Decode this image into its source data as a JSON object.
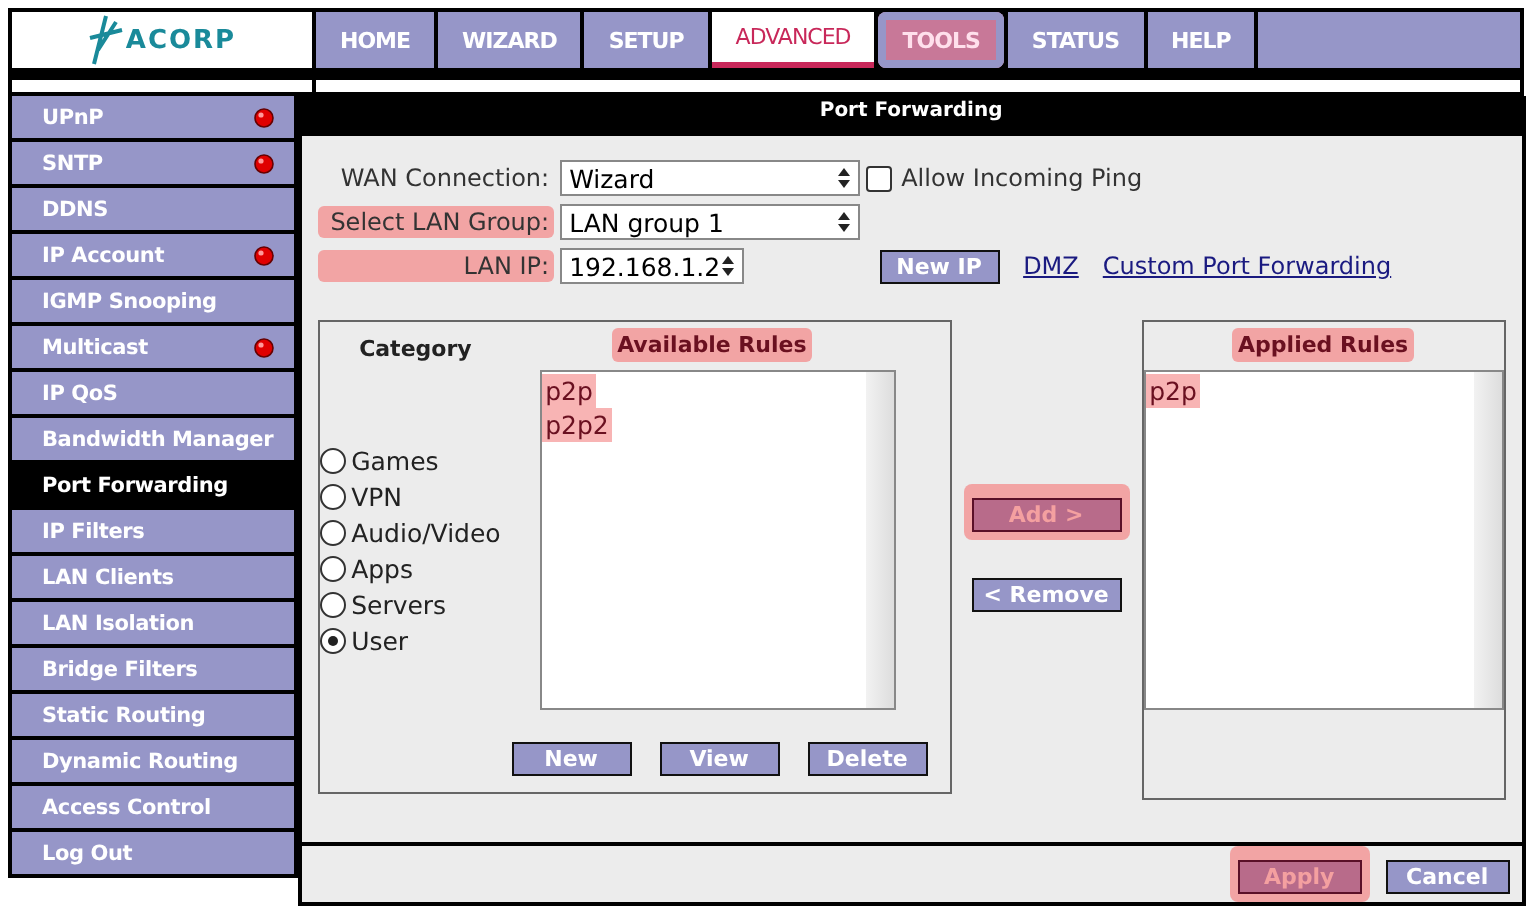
{
  "logo": "ACORP",
  "nav": [
    {
      "label": "HOME",
      "selected": false,
      "highlighted": false
    },
    {
      "label": "WIZARD",
      "selected": false,
      "highlighted": false
    },
    {
      "label": "SETUP",
      "selected": false,
      "highlighted": false
    },
    {
      "label": "ADVANCED",
      "selected": true,
      "highlighted": false
    },
    {
      "label": "TOOLS",
      "selected": false,
      "highlighted": true
    },
    {
      "label": "STATUS",
      "selected": false,
      "highlighted": false
    },
    {
      "label": "HELP",
      "selected": false,
      "highlighted": false
    }
  ],
  "sidebar": [
    {
      "label": "UPnP",
      "selected": false,
      "alert": true
    },
    {
      "label": "SNTP",
      "selected": false,
      "alert": true
    },
    {
      "label": "DDNS",
      "selected": false,
      "alert": false
    },
    {
      "label": "IP Account",
      "selected": false,
      "alert": true
    },
    {
      "label": "IGMP Snooping",
      "selected": false,
      "alert": false
    },
    {
      "label": "Multicast",
      "selected": false,
      "alert": true
    },
    {
      "label": "IP QoS",
      "selected": false,
      "alert": false
    },
    {
      "label": "Bandwidth Manager",
      "selected": false,
      "alert": false
    },
    {
      "label": "Port Forwarding",
      "selected": true,
      "alert": false
    },
    {
      "label": "IP Filters",
      "selected": false,
      "alert": false
    },
    {
      "label": "LAN Clients",
      "selected": false,
      "alert": false
    },
    {
      "label": "LAN Isolation",
      "selected": false,
      "alert": false
    },
    {
      "label": "Bridge Filters",
      "selected": false,
      "alert": false
    },
    {
      "label": "Static Routing",
      "selected": false,
      "alert": false
    },
    {
      "label": "Dynamic Routing",
      "selected": false,
      "alert": false
    },
    {
      "label": "Access Control",
      "selected": false,
      "alert": false
    },
    {
      "label": "Log Out",
      "selected": false,
      "alert": false
    }
  ],
  "panel": {
    "title": "Port Forwarding",
    "wan_connection": {
      "label": "WAN Connection:",
      "highlighted": false,
      "value": "Wizard"
    },
    "allow_ping": {
      "label": "Allow Incoming Ping",
      "checked": false
    },
    "lan_group": {
      "label": "Select LAN Group:",
      "highlighted": true,
      "value": "LAN group 1"
    },
    "lan_ip": {
      "label": "LAN IP:",
      "highlighted": true,
      "value": "192.168.1.2"
    },
    "new_ip": "New IP",
    "links": [
      "DMZ",
      "Custom Port Forwarding"
    ],
    "category": {
      "title": "Category",
      "options": [
        {
          "label": "Games",
          "selected": false
        },
        {
          "label": "VPN",
          "selected": false
        },
        {
          "label": "Audio/Video",
          "selected": false
        },
        {
          "label": "Apps",
          "selected": false
        },
        {
          "label": "Servers",
          "selected": false
        },
        {
          "label": "User",
          "selected": true
        }
      ]
    },
    "available": {
      "title": "Available Rules",
      "highlighted": true,
      "rules": [
        {
          "label": "p2p",
          "highlighted": true
        },
        {
          "label": "p2p2",
          "highlighted": true
        }
      ]
    },
    "rule_buttons": [
      "New",
      "View",
      "Delete"
    ],
    "add": {
      "label": "Add >",
      "highlighted": true
    },
    "remove": {
      "label": "< Remove",
      "highlighted": false
    },
    "applied": {
      "title": "Applied Rules",
      "highlighted": true,
      "rules": [
        {
          "label": "p2p",
          "highlighted": true
        }
      ]
    },
    "footer_buttons": [
      {
        "label": "Apply",
        "highlighted": true
      },
      {
        "label": "Cancel",
        "highlighted": false
      }
    ]
  }
}
